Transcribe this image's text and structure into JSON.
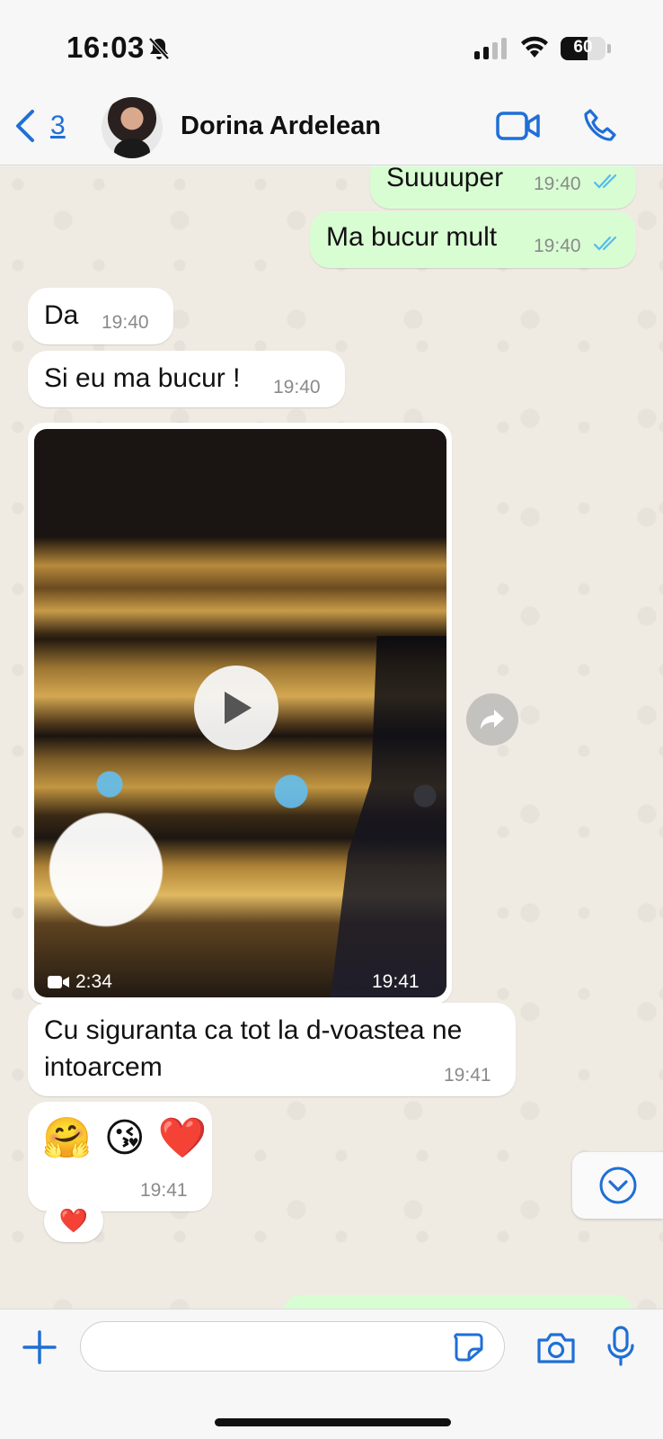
{
  "status_bar": {
    "time": "16:03",
    "battery_level": "60",
    "battery_fraction": 0.6,
    "icons": [
      "bell-slash-icon",
      "signal-icon",
      "wifi-icon",
      "battery-icon"
    ]
  },
  "header": {
    "back_count": "3",
    "contact_name": "Dorina Ardelean",
    "icons": [
      "chevron-left-icon",
      "video-camera-icon",
      "phone-icon"
    ]
  },
  "messages": [
    {
      "direction": "out",
      "text": "Suuuuper",
      "time": "19:40",
      "status": "read"
    },
    {
      "direction": "out",
      "text": "Ma bucur mult",
      "time": "19:40",
      "status": "read"
    },
    {
      "direction": "in",
      "text": "Da",
      "time": "19:40"
    },
    {
      "direction": "in",
      "text": "Si eu ma bucur !",
      "time": "19:40"
    },
    {
      "direction": "in",
      "type": "video",
      "duration": "2:34",
      "time": "19:41"
    },
    {
      "direction": "in",
      "text": "Cu siguranta ca tot la d-voastea ne intoarcem",
      "time": "19:41"
    },
    {
      "direction": "in",
      "text": "🤗 😘 ❤️",
      "time": "19:41",
      "reaction": "❤️"
    }
  ],
  "input": {
    "placeholder": "",
    "icons": [
      "plus-icon",
      "sticker-icon",
      "camera-icon",
      "microphone-icon"
    ]
  },
  "colors": {
    "accent": "#1f6fd6",
    "outgoing_bubble": "#d9fdd3",
    "incoming_bubble": "#ffffff",
    "chat_background": "#efeae2",
    "read_ticks": "#53bdeb"
  }
}
